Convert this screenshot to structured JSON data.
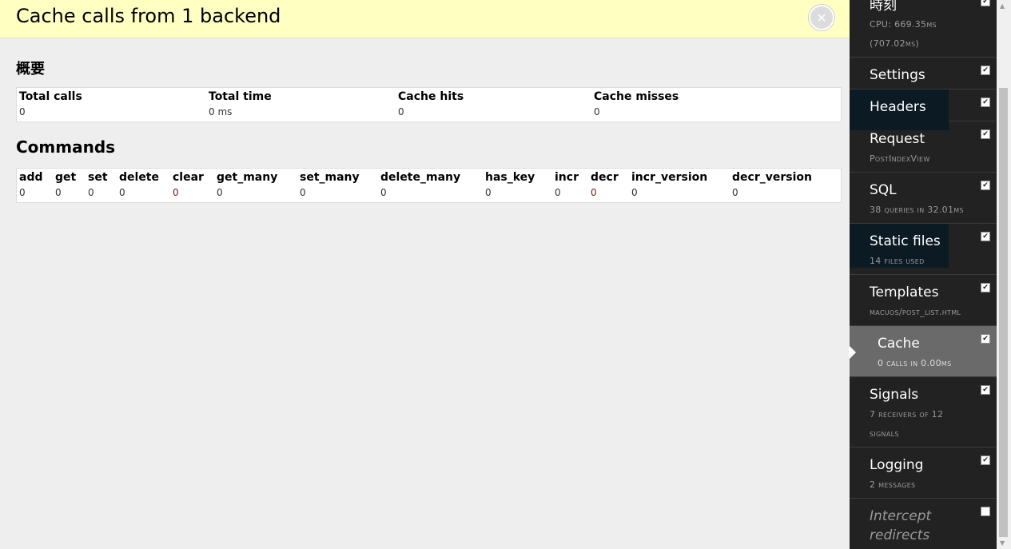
{
  "header": {
    "title": "Cache calls from 1 backend",
    "close_icon": "close-icon"
  },
  "summary": {
    "title": "概要",
    "columns": [
      "Total calls",
      "Total time",
      "Cache hits",
      "Cache misses"
    ],
    "values": [
      "0",
      "0 ms",
      "0",
      "0"
    ]
  },
  "commands": {
    "title": "Commands",
    "columns": [
      "add",
      "get",
      "set",
      "delete",
      "clear",
      "get_many",
      "set_many",
      "delete_many",
      "has_key",
      "incr",
      "decr",
      "incr_version",
      "decr_version"
    ],
    "values": [
      "0",
      "0",
      "0",
      "0",
      "0",
      "0",
      "0",
      "0",
      "0",
      "0",
      "0",
      "0",
      "0"
    ]
  },
  "toolbar": {
    "panels": [
      {
        "title": "時刻",
        "sub1": "CPU: 669.35ms",
        "sub2": "(707.02ms)",
        "checked": true
      },
      {
        "title": "Settings",
        "checked": true
      },
      {
        "title": "Headers",
        "checked": true
      },
      {
        "title": "Request",
        "sub1": "PostIndexView",
        "checked": true
      },
      {
        "title": "SQL",
        "sub1": "38 queries in 32.01ms",
        "checked": true
      },
      {
        "title": "Static files",
        "sub1": "14 files used",
        "checked": true
      },
      {
        "title": "Templates",
        "sub1": "macuos/post_list.html",
        "checked": true
      },
      {
        "title": "Cache",
        "sub1": "0 calls in 0.00ms",
        "checked": true,
        "active": true
      },
      {
        "title": "Signals",
        "sub1": "7 receivers of 12",
        "sub2": "signals",
        "checked": true
      },
      {
        "title": "Logging",
        "sub1": "2 messages",
        "checked": true
      },
      {
        "title": "Intercept",
        "title2": "redirects",
        "checked": false
      }
    ],
    "check_mark": "✔"
  }
}
